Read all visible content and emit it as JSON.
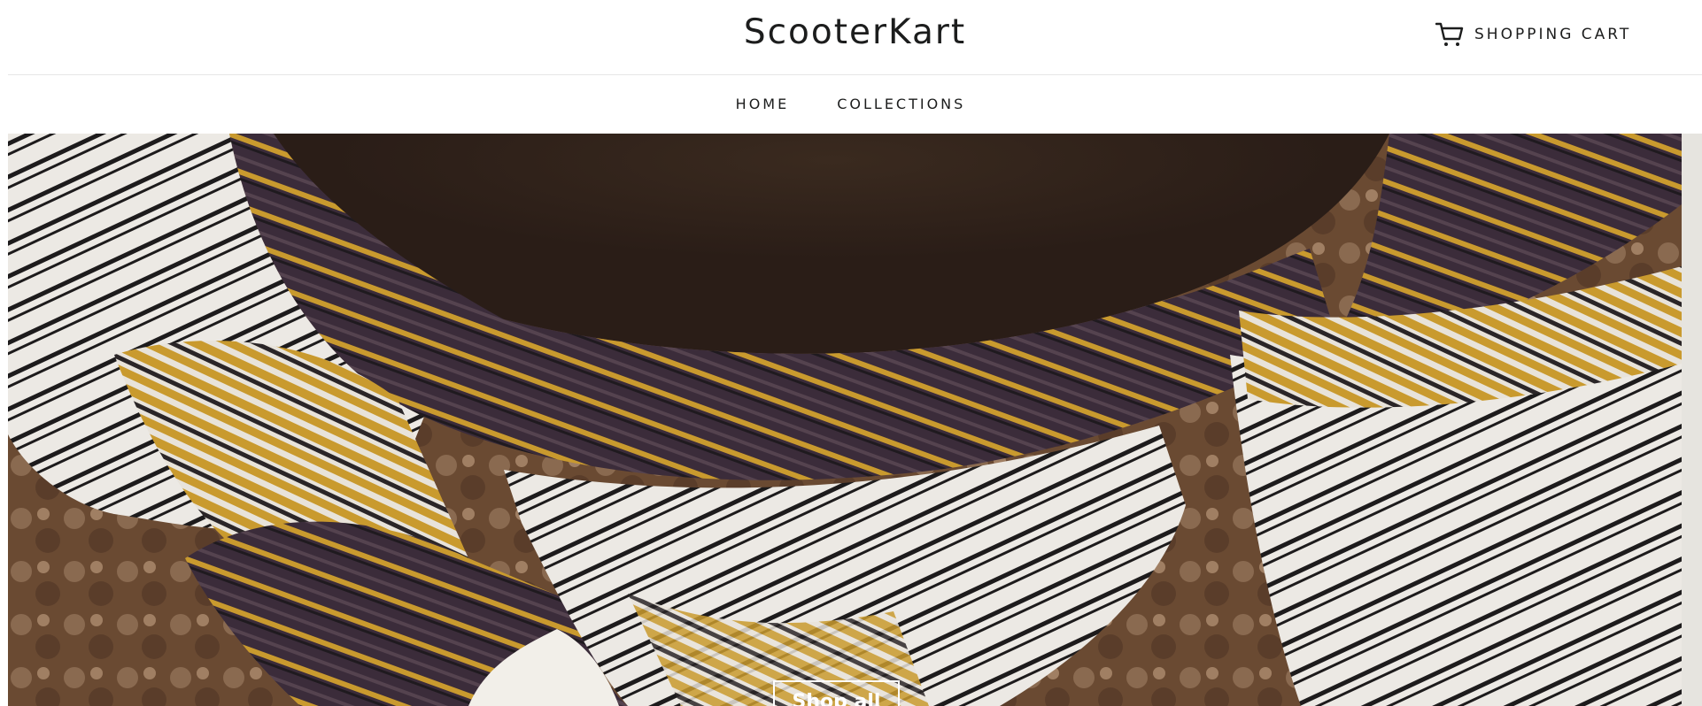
{
  "header": {
    "brand": "ScooterKart",
    "cart_label": "SHOPPING CART",
    "cart_icon": "shopping-cart-icon"
  },
  "nav": {
    "items": [
      {
        "label": "HOME"
      },
      {
        "label": "COLLECTIONS"
      }
    ]
  },
  "hero": {
    "image": "woven striped blanket with mustard, white and black stripes",
    "button_label": "Shop all"
  },
  "colors": {
    "text": "#1c1d1d",
    "border": "#e6e6e6",
    "mustard": "#c99a2e",
    "plum": "#3b2c3a"
  }
}
